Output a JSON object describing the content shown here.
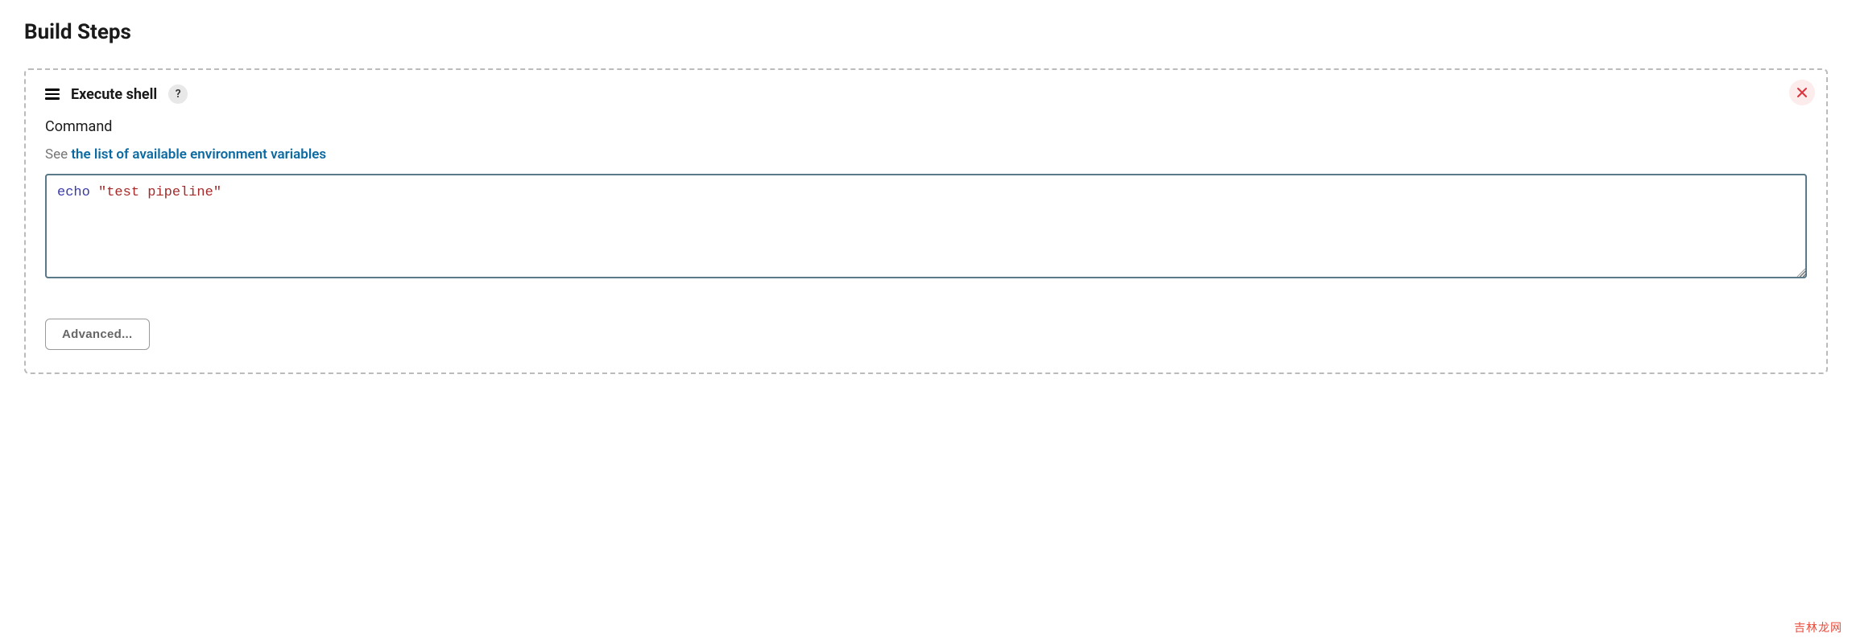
{
  "section": {
    "title": "Build Steps"
  },
  "step": {
    "title": "Execute shell",
    "help_symbol": "?",
    "field_label": "Command",
    "help_prefix": "See ",
    "help_link_text": "the list of available environment variables",
    "command": {
      "keyword": "echo",
      "string": "\"test pipeline\""
    },
    "advanced_button": "Advanced..."
  },
  "watermark": "吉林龙网"
}
